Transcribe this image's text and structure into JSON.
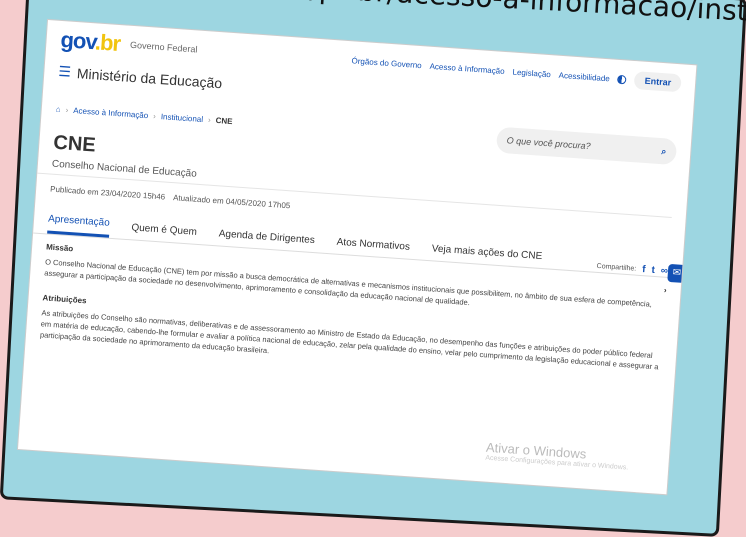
{
  "caption": "/mec/pt-br/acesso‑a‑informacao/institucional/cne",
  "header": {
    "logo_a": "gov",
    "logo_b": ".br",
    "gov_label": "Governo Federal",
    "links": [
      "Órgãos do Governo",
      "Acesso à Informação",
      "Legislação",
      "Acessibilidade"
    ],
    "entrar": "Entrar",
    "ministry": "Ministério da Educação"
  },
  "breadcrumb": [
    "Acesso à Informação",
    "Institucional",
    "CNE"
  ],
  "search": {
    "placeholder": "O que você procura?"
  },
  "page": {
    "title": "CNE",
    "subtitle": "Conselho Nacional de Educação",
    "published": "Publicado em 23/04/2020 15h46",
    "updated": "Atualizado em 04/05/2020 17h05"
  },
  "tabs": [
    "Apresentação",
    "Quem é Quem",
    "Agenda de Dirigentes",
    "Atos Normativos",
    "Veja mais ações do CNE"
  ],
  "share_label": "Compartilhe:",
  "sections": {
    "missao_title": "Missão",
    "missao_text": "O Conselho Nacional de Educação (CNE) tem por missão a busca democrática de alternativas e mecanismos institucionais que possibilitem, no âmbito de sua esfera de competência, assegurar a participação da sociedade no desenvolvimento, aprimoramento e consolidação da educação nacional de qualidade.",
    "atrib_title": "Atribuições",
    "atrib_text": "As atribuições do Conselho são normativas, deliberativas e de assessoramento ao Ministro de Estado da Educação, no desempenho das funções e atribuições do poder público federal em matéria de educação, cabendo-lhe formular e avaliar a política nacional de educação, zelar pela qualidade do ensino, velar pelo cumprimento da legislação educacional e assegurar a participação da sociedade no aprimoramento da educação brasileira."
  },
  "watermark": {
    "line1": "Ativar o Windows",
    "line2": "Acesse Configurações para ativar o Windows."
  }
}
